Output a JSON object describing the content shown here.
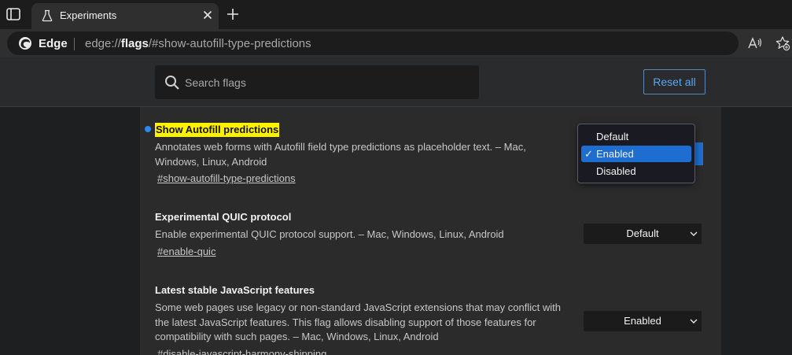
{
  "tab": {
    "title": "Experiments"
  },
  "omnibox": {
    "label": "Edge",
    "url_prefix": "edge://",
    "url_bold": "flags",
    "url_rest": "/#show-autofill-type-predictions"
  },
  "header": {
    "search_placeholder": "Search flags",
    "reset_label": "Reset all"
  },
  "flags": [
    {
      "title": "Show Autofill predictions",
      "description": "Annotates web forms with Autofill field type predictions as placeholder text. – Mac, Windows, Linux, Android",
      "link": "#show-autofill-type-predictions",
      "value": "Enabled",
      "highlighted": true
    },
    {
      "title": "Experimental QUIC protocol",
      "description": "Enable experimental QUIC protocol support. – Mac, Windows, Linux, Android",
      "link": "#enable-quic",
      "value": "Default"
    },
    {
      "title": "Latest stable JavaScript features",
      "description": "Some web pages use legacy or non-standard JavaScript extensions that may conflict with the latest JavaScript features. This flag allows disabling support of those features for compatibility with such pages. – Mac, Windows, Linux, Android",
      "link": "#disable-javascript-harmony-shipping",
      "value": "Enabled"
    }
  ],
  "dropdown": {
    "options": [
      "Default",
      "Enabled",
      "Disabled"
    ],
    "selected": "Enabled",
    "check_glyph": "✓"
  },
  "colors": {
    "accent": "#1d6ed0",
    "highlight": "#fff200",
    "link_blue": "#5aa6ef"
  }
}
